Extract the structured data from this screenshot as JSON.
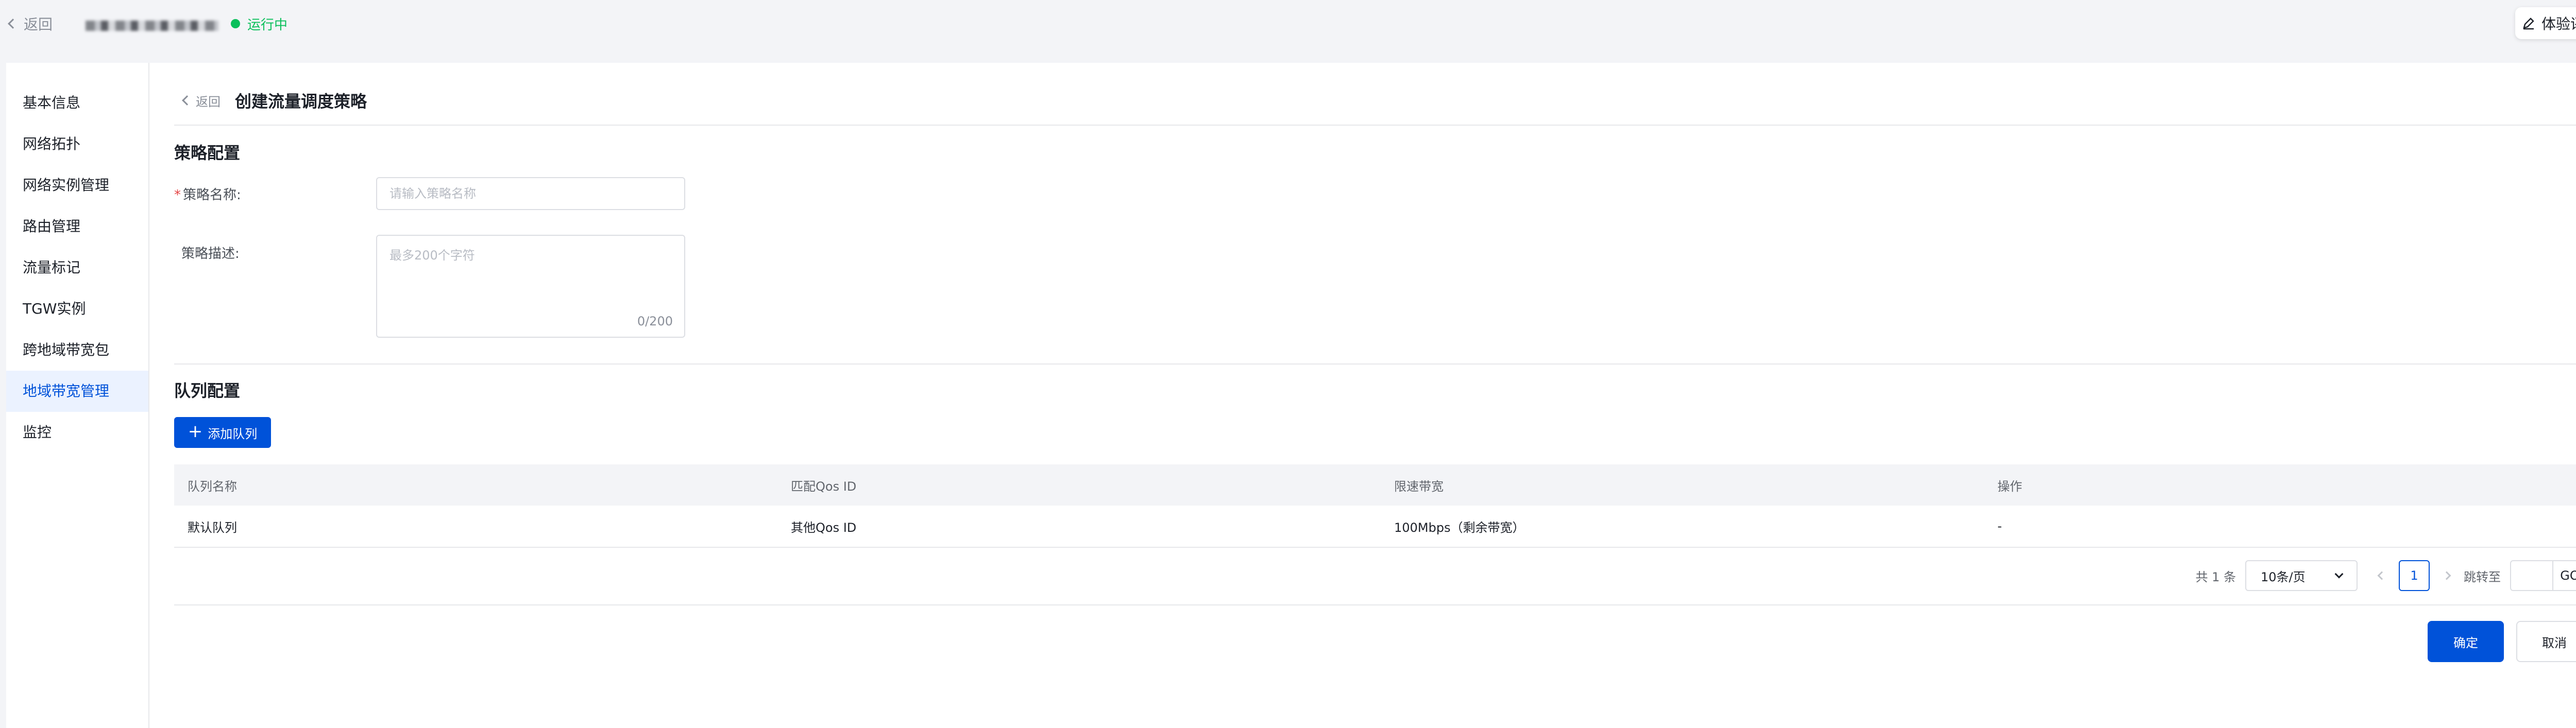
{
  "topbar": {
    "back_label": "返回",
    "status_label": "运行中",
    "status_color": "#0abf5b",
    "rate_label": "体验评分"
  },
  "sidebar": {
    "items": [
      {
        "label": "基本信息"
      },
      {
        "label": "网络拓扑"
      },
      {
        "label": "网络实例管理"
      },
      {
        "label": "路由管理"
      },
      {
        "label": "流量标记"
      },
      {
        "label": "TGW实例"
      },
      {
        "label": "跨地域带宽包"
      },
      {
        "label": "地域带宽管理",
        "active": true
      },
      {
        "label": "监控"
      }
    ]
  },
  "page": {
    "back_label": "返回",
    "title": "创建流量调度策略"
  },
  "policy_section": {
    "title": "策略配置",
    "name_label": "策略名称:",
    "required_mark": "*",
    "name_placeholder": "请输入策略名称",
    "desc_label": "策略描述:",
    "desc_placeholder": "最多200个字符",
    "desc_counter": "0/200"
  },
  "queue_section": {
    "title": "队列配置",
    "add_button_label": "添加队列",
    "columns": [
      "队列名称",
      "匹配Qos ID",
      "限速带宽",
      "操作"
    ],
    "rows": [
      [
        "默认队列",
        "其他Qos ID",
        "100Mbps（剩余带宽）",
        "-"
      ]
    ]
  },
  "pagination": {
    "total_text": "共 1 条",
    "page_size": "10条/页",
    "current_page": "1",
    "jump_label": "跳转至",
    "go_label": "GO"
  },
  "footer": {
    "confirm_label": "确定",
    "cancel_label": "取消"
  },
  "colors": {
    "primary": "#0052d9",
    "sidebar_active_bg": "#ebf2ff"
  }
}
